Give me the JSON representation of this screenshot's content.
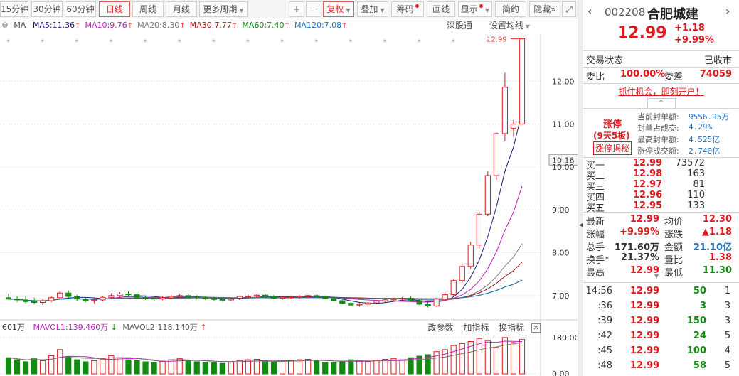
{
  "toolbar": {
    "period_tabs": [
      "15分钟",
      "30分钟",
      "60分钟"
    ],
    "day_tab": "日线",
    "week_tab": "周线",
    "month_tab": "月线",
    "more_period": "更多周期",
    "plus": "+",
    "minus": "一",
    "fuquan": "复权",
    "dieja": "叠加",
    "chouma": "筹码",
    "huaxian": "画线",
    "xianshi": "显示",
    "jianyue": "简约",
    "yincang": "隐藏",
    "yincang_arrows": "»",
    "maximize": "⤢"
  },
  "ma_legend": {
    "ma": "MA",
    "items": [
      {
        "label": "MA5:11.36",
        "color": "#1b1b7a",
        "arrow": "↑",
        "arrow_color": "#e03030"
      },
      {
        "label": "MA10:9.76",
        "color": "#c020c0",
        "arrow": "↑",
        "arrow_color": "#e03030"
      },
      {
        "label": "MA20:8.30",
        "color": "#777777",
        "arrow": "↑",
        "arrow_color": "#e03030"
      },
      {
        "label": "MA30:7.77",
        "color": "#9a1010",
        "arrow": "↑",
        "arrow_color": "#e03030"
      },
      {
        "label": "MA60:7.40",
        "color": "#167a16",
        "arrow": "↑",
        "arrow_color": "#e03030"
      },
      {
        "label": "MA120:7.08",
        "color": "#2070c0",
        "arrow": "↑",
        "arrow_color": "#e03030"
      }
    ],
    "shenguotong": "深股通",
    "set_ma": "设置均线",
    "high_marker": "12.99"
  },
  "price_axis": {
    "ticks": [
      "12.00",
      "11.00",
      "10.16",
      "10.00",
      "9.00",
      "8.00",
      "7.00"
    ]
  },
  "volume": {
    "vol": "601万",
    "mavol1": "MAVOL1:139.460万",
    "mavol2": "MAVOL2:118.140万",
    "change_params": "改参数",
    "add_indicator": "加指标",
    "switch_indicator": "换指标",
    "close": "×",
    "axis_ticks": [
      "180.00",
      "0.00"
    ]
  },
  "chart_data": {
    "type": "candlestick",
    "symbol": "002208",
    "last": 12.99,
    "ylim": [
      6.5,
      13.1
    ],
    "candles": [
      [
        6.95,
        7.05,
        6.9,
        6.92
      ],
      [
        6.92,
        6.98,
        6.85,
        6.9
      ],
      [
        6.9,
        7.0,
        6.82,
        6.86
      ],
      [
        6.86,
        6.95,
        6.8,
        6.84
      ],
      [
        6.84,
        6.92,
        6.78,
        6.88
      ],
      [
        6.88,
        6.98,
        6.85,
        6.95
      ],
      [
        6.95,
        7.1,
        6.92,
        7.06
      ],
      [
        7.06,
        7.12,
        6.95,
        6.98
      ],
      [
        6.98,
        7.02,
        6.88,
        6.92
      ],
      [
        6.92,
        6.96,
        6.85,
        6.88
      ],
      [
        6.88,
        6.94,
        6.82,
        6.9
      ],
      [
        6.9,
        6.98,
        6.86,
        6.96
      ],
      [
        6.96,
        7.05,
        6.92,
        7.0
      ],
      [
        7.0,
        7.08,
        6.96,
        7.04
      ],
      [
        7.04,
        7.1,
        6.98,
        7.02
      ],
      [
        7.02,
        7.06,
        6.94,
        6.96
      ],
      [
        6.96,
        7.0,
        6.9,
        6.94
      ],
      [
        6.94,
        6.99,
        6.88,
        6.92
      ],
      [
        6.92,
        6.98,
        6.89,
        6.95
      ],
      [
        6.95,
        7.02,
        6.92,
        6.98
      ],
      [
        6.98,
        7.04,
        6.94,
        7.0
      ],
      [
        7.0,
        7.05,
        6.95,
        6.97
      ],
      [
        6.97,
        7.01,
        6.92,
        6.95
      ],
      [
        6.95,
        6.98,
        6.9,
        6.93
      ],
      [
        6.93,
        6.97,
        6.88,
        6.91
      ],
      [
        6.91,
        6.95,
        6.86,
        6.9
      ],
      [
        6.9,
        6.96,
        6.87,
        6.94
      ],
      [
        6.94,
        7.0,
        6.9,
        6.98
      ],
      [
        6.98,
        7.02,
        6.94,
        6.99
      ],
      [
        6.99,
        7.03,
        6.95,
        7.01
      ],
      [
        7.01,
        7.04,
        6.96,
        6.98
      ],
      [
        6.98,
        7.01,
        6.92,
        6.94
      ],
      [
        6.94,
        6.98,
        6.9,
        6.96
      ],
      [
        6.96,
        7.0,
        6.92,
        6.97
      ],
      [
        6.97,
        7.01,
        6.93,
        6.99
      ],
      [
        6.99,
        7.02,
        6.95,
        7.0
      ],
      [
        7.0,
        7.03,
        6.96,
        6.98
      ],
      [
        6.98,
        7.0,
        6.92,
        6.93
      ],
      [
        6.93,
        6.96,
        6.86,
        6.88
      ],
      [
        6.88,
        6.92,
        6.8,
        6.82
      ],
      [
        6.82,
        6.86,
        6.75,
        6.78
      ],
      [
        6.78,
        6.84,
        6.74,
        6.8
      ],
      [
        6.8,
        6.86,
        6.76,
        6.83
      ],
      [
        6.83,
        6.9,
        6.8,
        6.87
      ],
      [
        6.87,
        6.92,
        6.83,
        6.9
      ],
      [
        6.9,
        6.95,
        6.86,
        6.92
      ],
      [
        6.92,
        6.97,
        6.88,
        6.94
      ],
      [
        6.94,
        6.98,
        6.85,
        6.88
      ],
      [
        6.88,
        6.92,
        6.78,
        6.8
      ],
      [
        6.8,
        6.86,
        6.72,
        6.76
      ],
      [
        6.76,
        6.95,
        6.74,
        6.92
      ],
      [
        6.92,
        7.1,
        6.88,
        7.02
      ],
      [
        7.02,
        7.4,
        7.0,
        7.35
      ],
      [
        7.35,
        7.75,
        7.3,
        7.68
      ],
      [
        7.68,
        8.25,
        7.62,
        8.18
      ],
      [
        8.18,
        8.95,
        8.1,
        8.9
      ],
      [
        8.9,
        9.9,
        8.85,
        9.8
      ],
      [
        9.8,
        10.8,
        9.7,
        10.78
      ],
      [
        10.78,
        12.2,
        10.6,
        11.86
      ],
      [
        10.9,
        11.1,
        10.7,
        11.0
      ],
      [
        11.0,
        12.99,
        11.0,
        12.99
      ]
    ],
    "ma_series": [
      {
        "name": "MA5",
        "value": 11.36
      },
      {
        "name": "MA10",
        "value": 9.76
      },
      {
        "name": "MA20",
        "value": 8.3
      },
      {
        "name": "MA30",
        "value": 7.77
      },
      {
        "name": "MA60",
        "value": 7.4
      },
      {
        "name": "MA120",
        "value": 7.08
      }
    ],
    "volume": [
      80,
      70,
      60,
      75,
      65,
      90,
      120,
      85,
      70,
      60,
      65,
      75,
      90,
      80,
      70,
      65,
      60,
      55,
      62,
      70,
      75,
      68,
      60,
      58,
      55,
      52,
      60,
      66,
      70,
      72,
      65,
      58,
      62,
      66,
      70,
      72,
      66,
      58,
      55,
      62,
      70,
      65,
      60,
      68,
      72,
      75,
      70,
      80,
      88,
      95,
      110,
      120,
      140,
      150,
      160,
      175,
      165,
      130,
      180,
      155,
      170
    ]
  },
  "panel": {
    "code": "002208",
    "name": "合肥城建",
    "price": "12.99",
    "change": "+1.18",
    "change_pct": "+9.99%",
    "trade_state_label": "交易状态",
    "trade_state": "已收市",
    "weibi_label": "委比",
    "weibi": "100.00%",
    "weicha_label": "委差",
    "weicha": "74059",
    "ad": "抓住机会，即刻开户！",
    "zt_label": "涨停",
    "zt_sub": "(9天5板)",
    "zt_btn": "涨停揭秘",
    "zt_stats": [
      {
        "label": "当前封单额:",
        "value": "9556.95万"
      },
      {
        "label": "封单占成交:",
        "value": "4.29%"
      },
      {
        "label": "最高封单额:",
        "value": "4.525亿"
      },
      {
        "label": "涨停成交额:",
        "value": "2.740亿"
      }
    ],
    "bids": [
      {
        "label": "买一",
        "price": "12.99",
        "vol": "73572"
      },
      {
        "label": "买二",
        "price": "12.98",
        "vol": "163"
      },
      {
        "label": "买三",
        "price": "12.97",
        "vol": "81"
      },
      {
        "label": "买四",
        "price": "12.96",
        "vol": "110"
      },
      {
        "label": "买五",
        "price": "12.95",
        "vol": "133"
      }
    ],
    "quote": [
      {
        "l1": "最新",
        "v1": "12.99",
        "c1": "red",
        "l2": "均价",
        "v2": "12.30",
        "c2": "red"
      },
      {
        "l1": "涨幅",
        "v1": "+9.99%",
        "c1": "red",
        "l2": "涨跌",
        "v2": "▲1.18",
        "c2": "red"
      },
      {
        "l1": "总手",
        "v1": "171.60万",
        "c1": "gray",
        "l2": "金额",
        "v2": "21.10亿",
        "c2": "blue"
      },
      {
        "l1": "换手*",
        "v1": "21.37%",
        "c1": "gray",
        "l2": "量比",
        "v2": "1.38",
        "c2": "red"
      },
      {
        "l1": "最高",
        "v1": "12.99",
        "c1": "red",
        "l2": "最低",
        "v2": "11.30",
        "c2": "green"
      }
    ],
    "ticks": [
      {
        "time": "14:56",
        "price": "12.99",
        "vol": "50",
        "n": "1"
      },
      {
        "time": ":36",
        "price": "12.99",
        "vol": "3",
        "n": "3"
      },
      {
        "time": ":39",
        "price": "12.99",
        "vol": "150",
        "n": "3"
      },
      {
        "time": ":42",
        "price": "12.99",
        "vol": "24",
        "n": "5"
      },
      {
        "time": ":45",
        "price": "12.99",
        "vol": "100",
        "n": "4"
      },
      {
        "time": ":48",
        "price": "12.99",
        "vol": "58",
        "n": "5"
      }
    ],
    "collapse": "^"
  },
  "colors": {
    "up": "#e0191e",
    "down": "#138a13",
    "grid": "#e8e8e8",
    "ma_blue": "#2070c0"
  }
}
